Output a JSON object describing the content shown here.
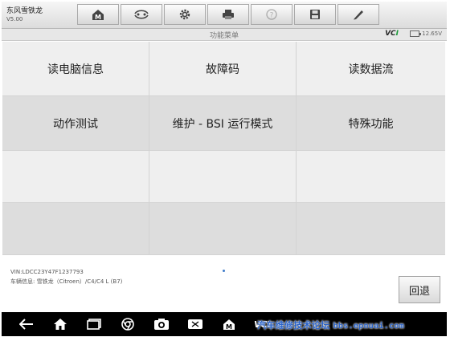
{
  "app": {
    "name": "东风雪铁龙",
    "version": "V5.00"
  },
  "toolbar": [
    {
      "icon": "home-m-icon"
    },
    {
      "icon": "vehicle-swap-icon"
    },
    {
      "icon": "settings-gear-icon"
    },
    {
      "icon": "print-icon"
    },
    {
      "icon": "help-icon",
      "disabled": true
    },
    {
      "icon": "save-icon"
    },
    {
      "icon": "pen-icon"
    }
  ],
  "titlebar": {
    "title": "功能菜单",
    "vci_prefix": "VC",
    "vci_suffix": "I",
    "voltage": "12.65V"
  },
  "menu": {
    "items": [
      {
        "label": "读电脑信息"
      },
      {
        "label": "故障码"
      },
      {
        "label": "读数据流"
      },
      {
        "label": "动作测试"
      },
      {
        "label": "维护 - BSI 运行模式"
      },
      {
        "label": "特殊功能"
      },
      {
        "label": ""
      },
      {
        "label": ""
      },
      {
        "label": ""
      },
      {
        "label": ""
      },
      {
        "label": ""
      },
      {
        "label": ""
      }
    ]
  },
  "footer": {
    "vin": "VIN:LDCC23Y47F1237793",
    "vehicle": "车辆信息: 雪铁龙（Citroen）/C4/C4 L (B7)",
    "back_label": "回退"
  },
  "navbar": {
    "icons": [
      "back-arrow-icon",
      "home-icon",
      "recent-apps-icon",
      "chrome-icon",
      "camera-icon",
      "screen-record-icon",
      "app-m-icon"
    ],
    "vci_text": "VCI",
    "watermark": "汽车维修技术论坛",
    "watermark_url": "bbs.epnuai.com"
  },
  "colors": {
    "accent": "#1c9a3a",
    "watermark": "#2a63c9",
    "row_light": "#efefef",
    "row_dark": "#dddddd"
  }
}
